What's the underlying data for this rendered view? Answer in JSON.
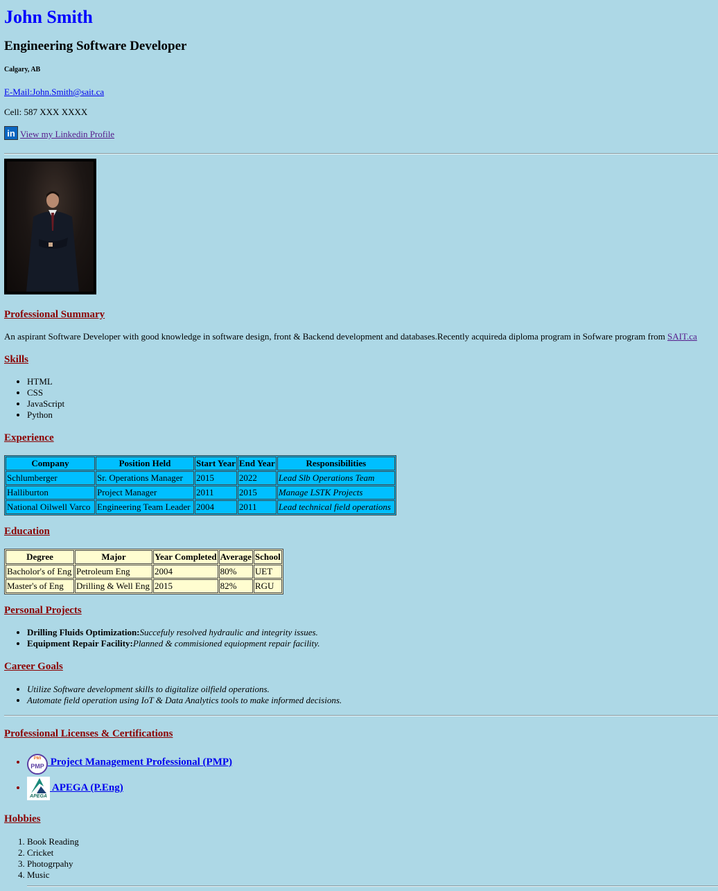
{
  "header": {
    "name": "John Smith",
    "role": "Engineering Software Developer",
    "location": "Calgary, AB",
    "email_text": "E-Mail:John.Smith@sait.ca",
    "cell": "Cell: 587 XXX XXXX",
    "linkedin_icon": "linkedin-icon",
    "linkedin_text": "View my Linkedin Profile"
  },
  "summary": {
    "title": "Professional Summary",
    "text": "An aspirant Software Developer with good knowledge in software design, front & Backend development and databases.Recently acquireda diploma program in Sofware program from ",
    "link": "SAIT.ca"
  },
  "skills": {
    "title": "Skills",
    "items": [
      "HTML",
      "CSS",
      "JavaScript",
      "Python"
    ]
  },
  "experience": {
    "title": "Experience",
    "headers": [
      "Company",
      "Position Held",
      "Start Year",
      "End Year",
      "Responsibilities"
    ],
    "rows": [
      [
        "Schlumberger",
        "Sr. Operations Manager",
        "2015",
        "2022",
        "Lead Slb Operations Team"
      ],
      [
        "Halliburton",
        "Project Manager",
        "2011",
        "2015",
        "Manage LSTK Projects"
      ],
      [
        "National Oilwell Varco",
        "Engineering Team Leader",
        "2004",
        "2011",
        "Lead technical field operations"
      ]
    ]
  },
  "education": {
    "title": "Education",
    "headers": [
      "Degree",
      "Major",
      "Year Completed",
      "Average",
      "School"
    ],
    "rows": [
      [
        "Bacholor's of Eng",
        "Petroleum Eng",
        "2004",
        "80%",
        "UET"
      ],
      [
        "Master's of Eng",
        "Drilling & Well Eng",
        "2015",
        "82%",
        "RGU"
      ]
    ]
  },
  "projects": {
    "title": "Personal Projects",
    "items": [
      {
        "name": "Drilling Fluids Optimization:",
        "desc": "Succefuly resolved hydraulic and integrity issues."
      },
      {
        "name": "Equipment Repair Facility:",
        "desc": "Planned & commisioned equiopment repair facility."
      }
    ]
  },
  "goals": {
    "title": "Career Goals",
    "items": [
      "Utilize Software development skills to digitalize oilfield operations.",
      "Automate field operation using IoT & Data Analytics tools to make informed decisions."
    ]
  },
  "certs": {
    "title": "Professional Licenses & Certifications",
    "items": [
      {
        "label": " Project Management Professional (PMP)",
        "badge": "PMP",
        "badge_top": "PMI"
      },
      {
        "label": " APEGA (P.Eng)",
        "badge": "APEGA"
      }
    ]
  },
  "hobbies": {
    "title": "Hobbies",
    "items": [
      "Book Reading",
      "Cricket",
      "Photogrpahy",
      "Music"
    ]
  }
}
